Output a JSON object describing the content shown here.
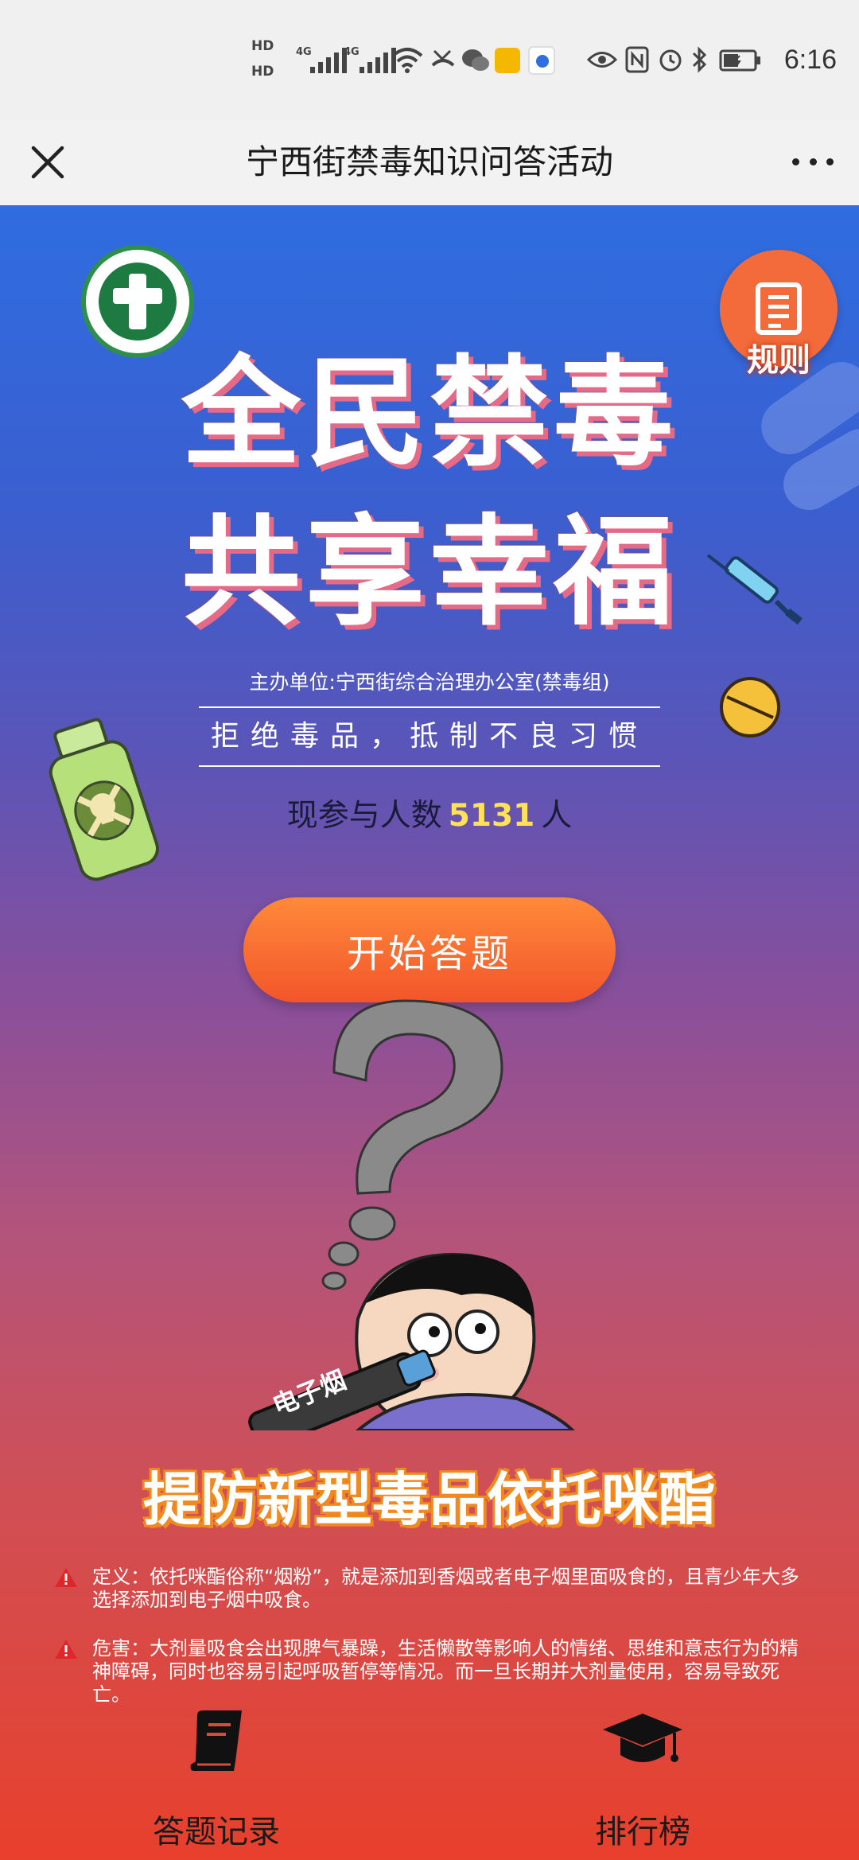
{
  "status_bar": {
    "hd1": "HD",
    "hd2": "HD",
    "net1": "4G",
    "net2": "4G",
    "time": "6:16"
  },
  "app_bar": {
    "title": "宁西街禁毒知识问答活动"
  },
  "poster": {
    "headline_line1": "全民禁毒",
    "headline_line2": "共享幸福",
    "rules_label": "规则",
    "sponsor": "主办单位:宁西街综合治理办公室(禁毒组)",
    "slogan": "拒绝毒品，抵制不良习惯",
    "participants_prefix": "现参与人数",
    "participants_count": "5131",
    "participants_suffix": "人",
    "start_button": "开始答题",
    "ecig_label": "电子烟",
    "subheadline": "提防新型毒品依托咪酯",
    "definition": "定义：依托咪酯俗称“烟粉”，就是添加到香烟或者电子烟里面吸食的，且青少年大多选择添加到电子烟中吸食。",
    "harm": "危害：大剂量吸食会出现脾气暴躁，生活懒散等影响人的情绪、思维和意志行为的精神障碍，同时也容易引起呼吸暂停等情况。而一旦长期并大剂量使用，容易导致死亡。"
  },
  "bottom_nav": {
    "records_label": "答题记录",
    "ranking_label": "排行榜"
  },
  "colors": {
    "start_button": "#f2552a",
    "count_highlight": "#ffe15a",
    "rules_badge": "#f36b3a"
  }
}
